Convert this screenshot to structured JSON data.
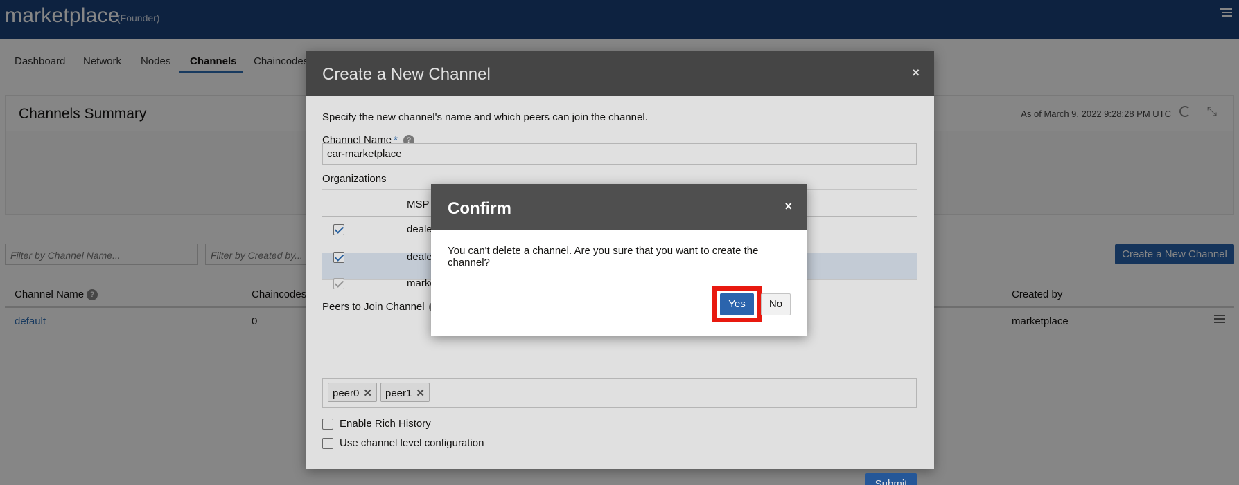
{
  "header": {
    "title": "marketplace",
    "role": "(Founder)"
  },
  "tabs": [
    "Dashboard",
    "Network",
    "Nodes",
    "Channels",
    "Chaincodes"
  ],
  "active_tab": "Channels",
  "summary": {
    "title": "Channels Summary",
    "as_of": "As of March 9, 2022 9:28:28 PM UTC"
  },
  "filters": {
    "channel_name_placeholder": "Filter by Channel Name...",
    "created_by_placeholder": "Filter by Created by..."
  },
  "create_channel_button": "Create a New Channel",
  "table": {
    "columns": [
      "Channel Name",
      "Chaincodes",
      "Created by"
    ],
    "rows": [
      {
        "channel_name": "default",
        "chaincodes": "0",
        "created_by": "marketplace"
      }
    ]
  },
  "dialog": {
    "title": "Create a New Channel",
    "close": "×",
    "description": "Specify the new channel's name and which peers can join the channel.",
    "channel_name_label": "Channel Name",
    "required_mark": "*",
    "channel_name_value": "car-marketplace",
    "organizations_label": "Organizations",
    "msp_header": "MSP",
    "org_rows": [
      "deale",
      "deale",
      "marke"
    ],
    "peers_label": "Peers to Join Channel",
    "peers": [
      "peer0",
      "peer1"
    ],
    "chip_remove": "✕",
    "enable_rich_history": "Enable Rich History",
    "use_channel_level_config": "Use channel level configuration",
    "submit": "Submit"
  },
  "confirm": {
    "title": "Confirm",
    "close": "×",
    "message": "You can't delete a channel. Are you sure that you want to create the channel?",
    "yes": "Yes",
    "no": "No"
  },
  "help_glyph": "?",
  "colors": {
    "header_bg": "#19427a",
    "accent": "#2b64ad",
    "dialog_header": "#4f4f4f",
    "highlight": "#e8190f"
  }
}
